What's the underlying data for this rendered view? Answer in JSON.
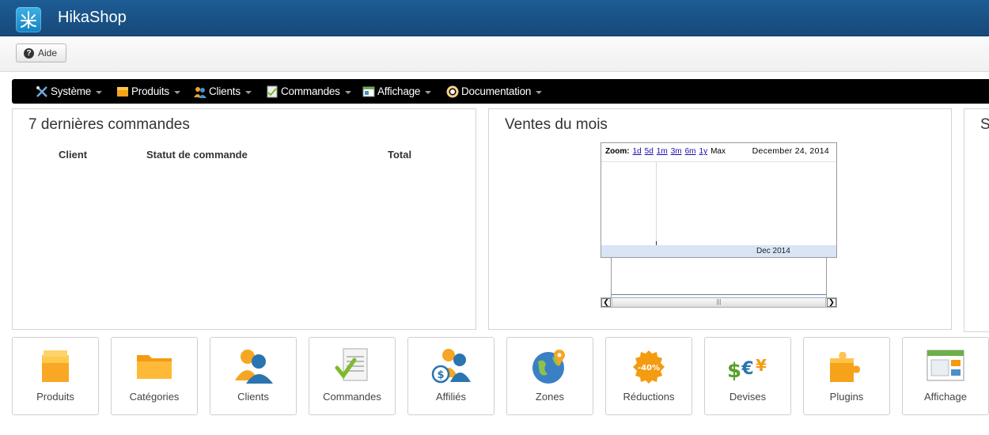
{
  "app": {
    "title": "HikaShop"
  },
  "toolbar": {
    "help_label": "Aide"
  },
  "nav": {
    "items": [
      {
        "label": "Système",
        "icon": "tools-icon"
      },
      {
        "label": "Produits",
        "icon": "box-icon"
      },
      {
        "label": "Clients",
        "icon": "users-icon"
      },
      {
        "label": "Commandes",
        "icon": "order-icon"
      },
      {
        "label": "Affichage",
        "icon": "display-icon"
      },
      {
        "label": "Documentation",
        "icon": "help-ring-icon"
      }
    ]
  },
  "orders_panel": {
    "title": "7 dernières commandes",
    "columns": [
      "Client",
      "Statut de commande",
      "Total"
    ]
  },
  "sales_panel": {
    "title": "Ventes du mois",
    "chart": {
      "zoom_label": "Zoom:",
      "zoom_options": [
        "1d",
        "5d",
        "1m",
        "3m",
        "6m",
        "1y",
        "Max"
      ],
      "date": "December 24, 2014",
      "axis_label": "Dec 2014"
    }
  },
  "third_panel": {
    "title": "S"
  },
  "tiles": [
    {
      "label": "Produits",
      "icon": "product-box-icon"
    },
    {
      "label": "Catégories",
      "icon": "folder-icon"
    },
    {
      "label": "Clients",
      "icon": "customers-icon"
    },
    {
      "label": "Commandes",
      "icon": "orders-document-icon"
    },
    {
      "label": "Affiliés",
      "icon": "affiliates-icon"
    },
    {
      "label": "Zones",
      "icon": "globe-icon"
    },
    {
      "label": "Réductions",
      "icon": "discount-badge-icon"
    },
    {
      "label": "Devises",
      "icon": "currency-icon"
    },
    {
      "label": "Plugins",
      "icon": "puzzle-icon"
    },
    {
      "label": "Affichage",
      "icon": "display-window-icon"
    }
  ],
  "discount_badge_text": "-40%",
  "colors": {
    "header": "#1d5c94",
    "nav": "#000000",
    "accent": "#f5a623"
  }
}
